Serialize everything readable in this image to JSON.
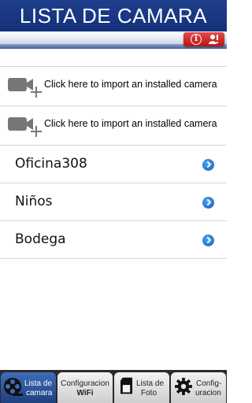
{
  "header": {
    "title": "LISTA DE CAMARA"
  },
  "alert_button": {
    "icons": [
      "info-icon",
      "user-alert-icon"
    ],
    "color": "#c82020"
  },
  "import_rows": [
    {
      "label": "Click here to import an installed camera",
      "icon": "camera-add-icon"
    },
    {
      "label": "Click here to import an installed camera",
      "icon": "camera-add-icon"
    }
  ],
  "cameras": [
    {
      "name": "Oficina308"
    },
    {
      "name": "Niños"
    },
    {
      "name": "Bodega"
    }
  ],
  "tabbar": {
    "tabs": [
      {
        "label_line1": "Lista de",
        "label_line2": "camara",
        "icon": "film-reel-icon",
        "active": true
      },
      {
        "label_line1": "Configuracion",
        "label_line2": "WiFi",
        "icon": "",
        "active": false
      },
      {
        "label_line1": "Lista de",
        "label_line2": "Foto",
        "icon": "sd-card-icon",
        "active": false
      },
      {
        "label_line1": "Config-",
        "label_line2": "uracion",
        "icon": "gear-icon",
        "active": false
      }
    ]
  },
  "colors": {
    "header": "#1a3a86",
    "accent": "#1f6fd0",
    "tabbar": "#2b2b2b"
  }
}
